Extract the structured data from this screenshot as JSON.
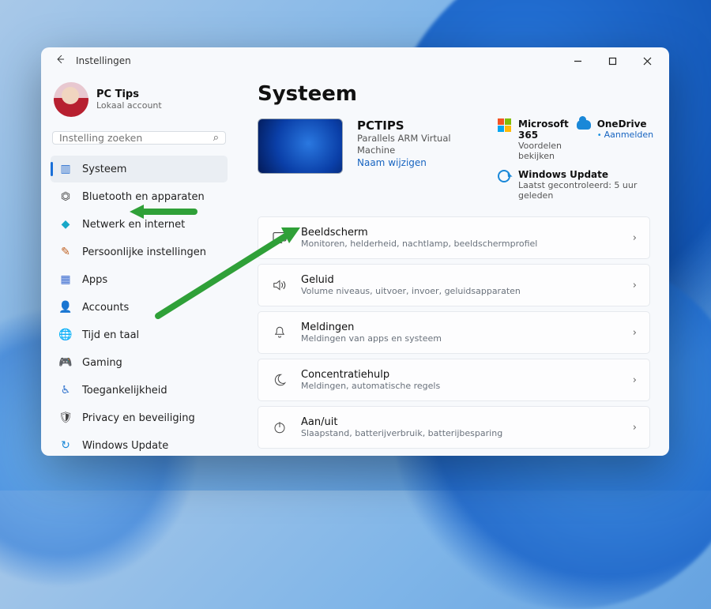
{
  "window": {
    "title": "Instellingen"
  },
  "profile": {
    "name": "PC Tips",
    "sub": "Lokaal account"
  },
  "search": {
    "placeholder": "Instelling zoeken"
  },
  "sidebar": {
    "items": [
      {
        "label": "Systeem"
      },
      {
        "label": "Bluetooth en apparaten"
      },
      {
        "label": "Netwerk en internet"
      },
      {
        "label": "Persoonlijke instellingen"
      },
      {
        "label": "Apps"
      },
      {
        "label": "Accounts"
      },
      {
        "label": "Tijd en taal"
      },
      {
        "label": "Gaming"
      },
      {
        "label": "Toegankelijkheid"
      },
      {
        "label": "Privacy en beveiliging"
      },
      {
        "label": "Windows Update"
      }
    ]
  },
  "main": {
    "heading": "Systeem",
    "pc": {
      "name": "PCTIPS",
      "model": "Parallels ARM Virtual Machine",
      "rename": "Naam wijzigen"
    },
    "cards": {
      "m365": {
        "title": "Microsoft 365",
        "sub": "Voordelen bekijken"
      },
      "onedrive": {
        "title": "OneDrive",
        "link": "Aanmelden"
      },
      "update": {
        "title": "Windows Update",
        "sub": "Laatst gecontroleerd: 5 uur geleden"
      }
    },
    "items": [
      {
        "title": "Beeldscherm",
        "sub": "Monitoren, helderheid, nachtlamp, beeldschermprofiel"
      },
      {
        "title": "Geluid",
        "sub": "Volume niveaus, uitvoer, invoer, geluidsapparaten"
      },
      {
        "title": "Meldingen",
        "sub": "Meldingen van apps en systeem"
      },
      {
        "title": "Concentratiehulp",
        "sub": "Meldingen, automatische regels"
      },
      {
        "title": "Aan/uit",
        "sub": "Slaapstand, batterijverbruik, batterijbesparing"
      }
    ]
  }
}
